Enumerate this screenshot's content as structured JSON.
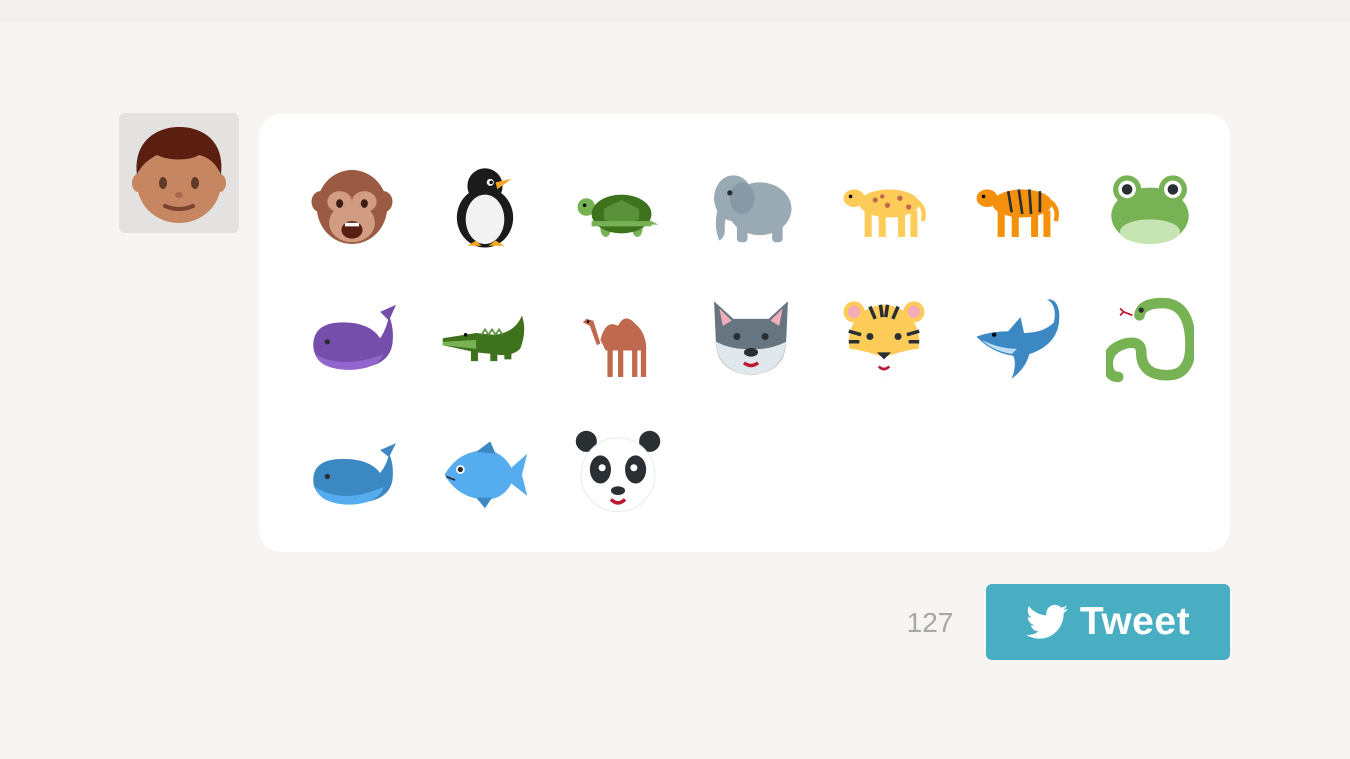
{
  "composer": {
    "avatar": {
      "icon": "boy-face-icon"
    },
    "emoji": [
      {
        "name": "monkey-face-icon"
      },
      {
        "name": "penguin-icon"
      },
      {
        "name": "turtle-icon"
      },
      {
        "name": "elephant-icon"
      },
      {
        "name": "leopard-icon"
      },
      {
        "name": "tiger-icon"
      },
      {
        "name": "frog-icon"
      },
      {
        "name": "whale-icon"
      },
      {
        "name": "crocodile-icon"
      },
      {
        "name": "camel-icon"
      },
      {
        "name": "wolf-icon"
      },
      {
        "name": "tiger-face-icon"
      },
      {
        "name": "dolphin-icon"
      },
      {
        "name": "snake-icon"
      },
      {
        "name": "spouting-whale-icon"
      },
      {
        "name": "fish-icon"
      },
      {
        "name": "panda-icon"
      }
    ]
  },
  "footer": {
    "char_count": "127",
    "tweet_label": "Tweet",
    "tweet_icon": "twitter-bird-icon"
  },
  "colors": {
    "background": "#f7f4f2",
    "card": "#ffffff",
    "button": "#4aaec3",
    "counter": "#a7a7a7"
  }
}
